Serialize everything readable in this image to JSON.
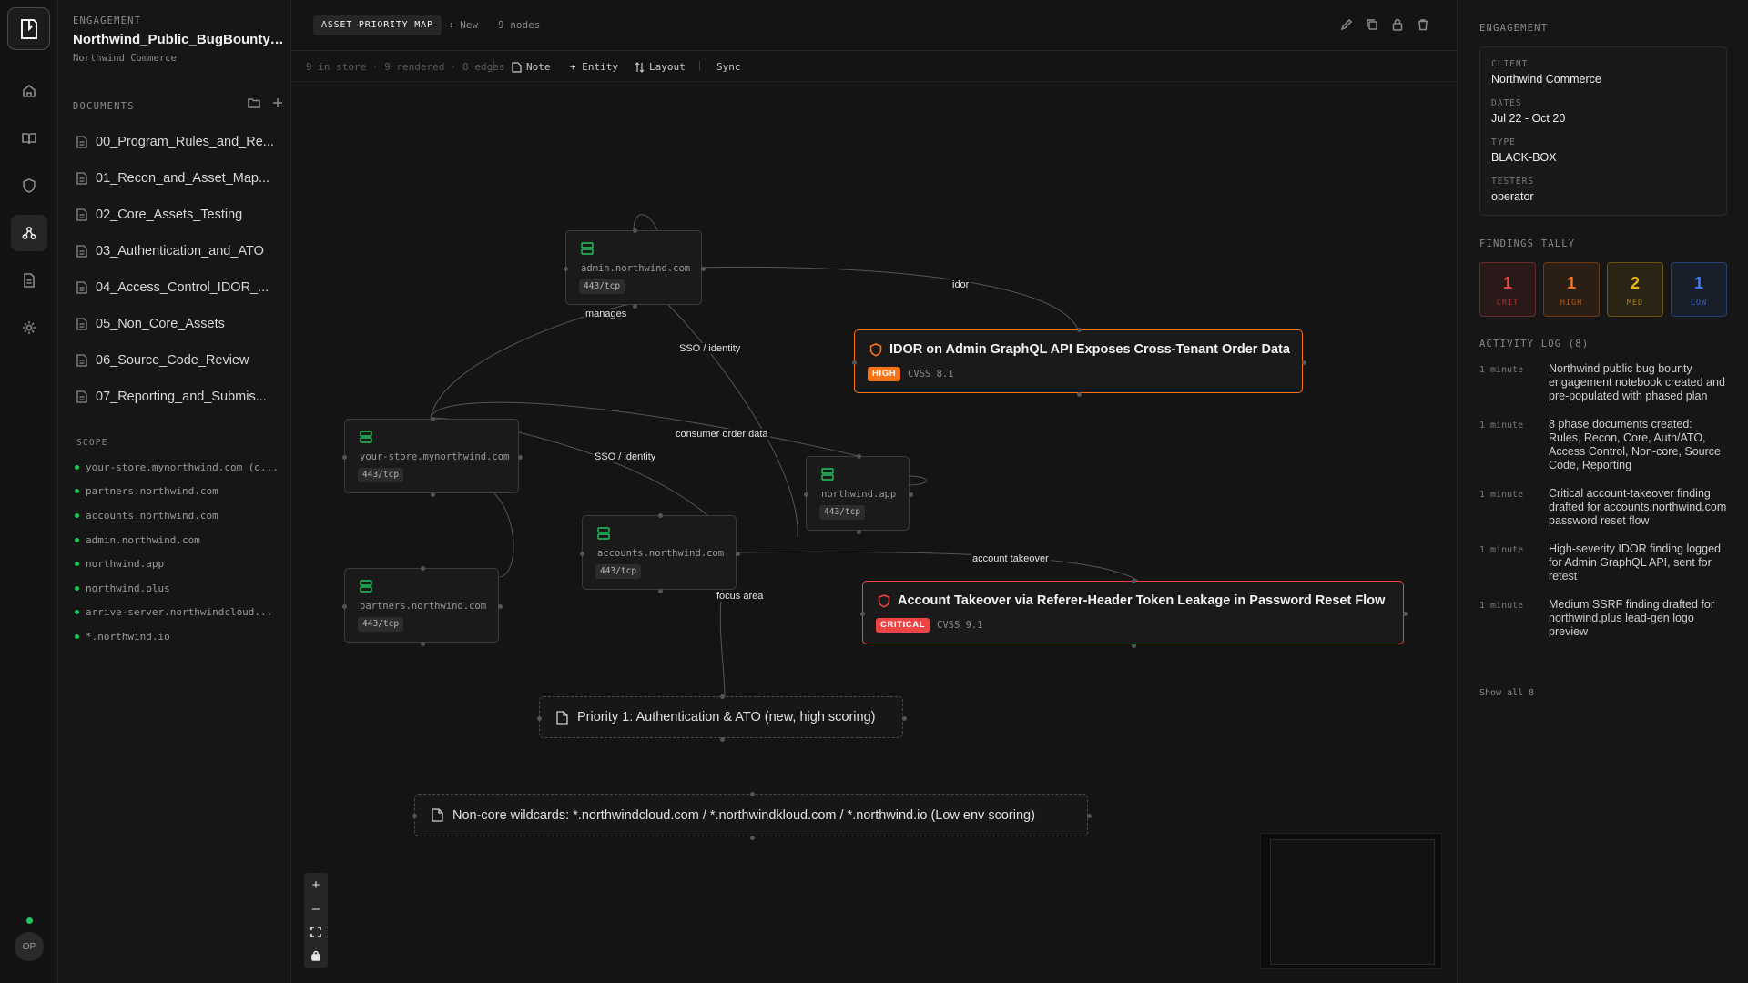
{
  "rail": {
    "avatar": "OP"
  },
  "left": {
    "eyebrow": "ENGAGEMENT",
    "title": "Northwind_Public_BugBounty_...",
    "subtitle": "Northwind Commerce",
    "documents_label": "DOCUMENTS",
    "documents": [
      "00_Program_Rules_and_Re...",
      "01_Recon_and_Asset_Map...",
      "02_Core_Assets_Testing",
      "03_Authentication_and_ATO",
      "04_Access_Control_IDOR_...",
      "05_Non_Core_Assets",
      "06_Source_Code_Review",
      "07_Reporting_and_Submis..."
    ],
    "scope_label": "SCOPE",
    "scope": [
      "your-store.mynorthwind.com (o...",
      "partners.northwind.com",
      "accounts.northwind.com",
      "admin.northwind.com",
      "northwind.app",
      "northwind.plus",
      "arrive-server.northwindcloud...",
      "*.northwind.io"
    ]
  },
  "topbar": {
    "tab": "ASSET PRIORITY MAP",
    "new": "+ New",
    "node_count": "9 nodes"
  },
  "subbar": {
    "stats": "9 in store · 9 rendered · 8 edges",
    "note": "Note",
    "entity": "+ Entity",
    "layout": "Layout",
    "sync": "Sync"
  },
  "canvas": {
    "assets": [
      {
        "host": "admin.northwind.com",
        "port": "443/tcp"
      },
      {
        "host": "your-store.mynorthwind.com",
        "port": "443/tcp"
      },
      {
        "host": "northwind.app",
        "port": "443/tcp"
      },
      {
        "host": "accounts.northwind.com",
        "port": "443/tcp"
      },
      {
        "host": "partners.northwind.com",
        "port": "443/tcp"
      }
    ],
    "findings": [
      {
        "title": "IDOR on Admin GraphQL API Exposes Cross-Tenant Order Data",
        "severity": "HIGH",
        "cvss": "CVSS 8.1",
        "color": "#f97316"
      },
      {
        "title": "Account Takeover via Referer-Header Token Leakage in Password Reset Flow",
        "severity": "CRITICAL",
        "cvss": "CVSS 9.1",
        "color": "#ef4444"
      }
    ],
    "notes": [
      "Priority 1: Authentication & ATO (new, high scoring)",
      "Non-core wildcards: *.northwindcloud.com / *.northwindkloud.com / *.northwind.io (Low env scoring)"
    ],
    "edge_labels": [
      "idor",
      "manages",
      "SSO / identity",
      "consumer order data",
      "SSO / identity",
      "account takeover",
      "focus area"
    ]
  },
  "right": {
    "engagement_label": "ENGAGEMENT",
    "client_k": "CLIENT",
    "client_v": "Northwind Commerce",
    "dates_k": "DATES",
    "dates_v": "Jul 22 - Oct 20",
    "type_k": "TYPE",
    "type_v": "BLACK-BOX",
    "testers_k": "TESTERS",
    "testers_v": "operator",
    "tally_label": "FINDINGS TALLY",
    "tally": [
      {
        "n": "1",
        "l": "CRIT",
        "color": "#ef4444"
      },
      {
        "n": "1",
        "l": "HIGH",
        "color": "#f97316"
      },
      {
        "n": "2",
        "l": "MED",
        "color": "#eab308"
      },
      {
        "n": "1",
        "l": "LOW",
        "color": "#3b82f6"
      }
    ],
    "activity_label": "ACTIVITY LOG (8)",
    "activity": [
      {
        "t": "1 minute",
        "d": "Northwind public bug bounty engagement notebook created and pre-populated with phased plan"
      },
      {
        "t": "1 minute",
        "d": "8 phase documents created: Rules, Recon, Core, Auth/ATO, Access Control, Non-core, Source Code, Reporting"
      },
      {
        "t": "1 minute",
        "d": "Critical account-takeover finding drafted for accounts.northwind.com password reset flow"
      },
      {
        "t": "1 minute",
        "d": "High-severity IDOR finding logged for Admin GraphQL API, sent for retest"
      },
      {
        "t": "1 minute",
        "d": "Medium SSRF finding drafted for northwind.plus lead-gen logo preview"
      }
    ],
    "show_all": "Show all 8"
  }
}
